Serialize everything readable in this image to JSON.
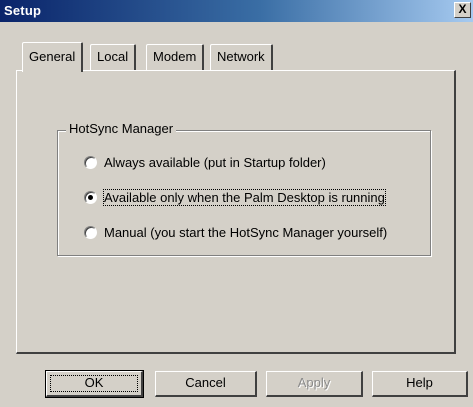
{
  "window": {
    "title": "Setup",
    "close_glyph": "X"
  },
  "tabs": [
    {
      "label": "General",
      "active": true
    },
    {
      "label": "Local",
      "active": false
    },
    {
      "label": "Modem",
      "active": false
    },
    {
      "label": "Network",
      "active": false
    }
  ],
  "hotsync": {
    "group_label": "HotSync Manager",
    "options": [
      {
        "label": "Always available (put in Startup folder)",
        "selected": false
      },
      {
        "label": "Available only when the Palm Desktop is running",
        "selected": true
      },
      {
        "label": "Manual (you start the HotSync Manager yourself)",
        "selected": false
      }
    ]
  },
  "buttons": {
    "ok": "OK",
    "cancel": "Cancel",
    "apply": "Apply",
    "help": "Help"
  },
  "apply_disabled": true
}
